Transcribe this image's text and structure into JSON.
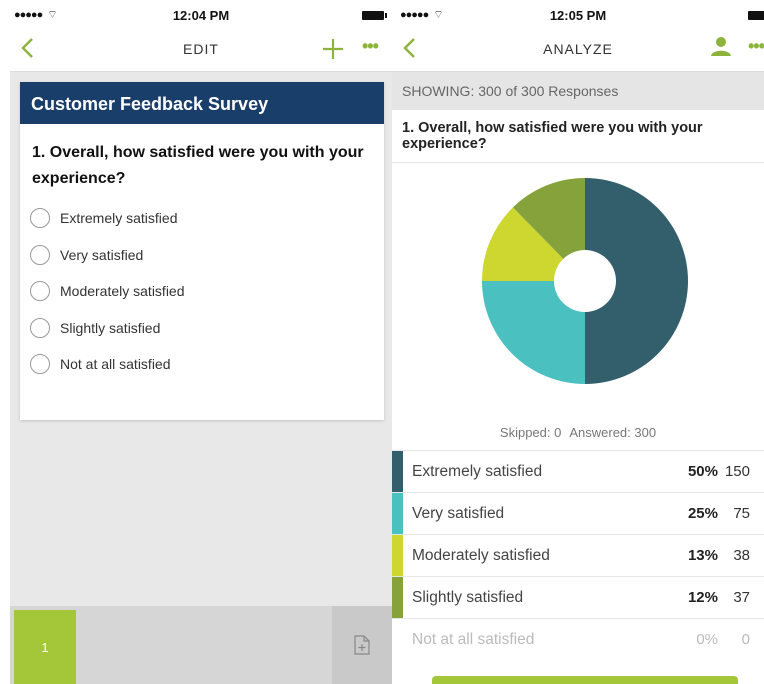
{
  "colors": {
    "accent": "#8cb43c",
    "header_blue": "#1a3e6a",
    "page_tab": "#a4c639",
    "series": [
      "#325f6b",
      "#4bc0c0",
      "#cdd730",
      "#86a23a",
      "#eeeeee"
    ]
  },
  "left": {
    "status": {
      "time": "12:04 PM",
      "signal_icon": "signal-dots-icon",
      "wifi_icon": "wifi-icon",
      "battery_icon": "battery-icon"
    },
    "nav": {
      "back_icon": "chevron-left-icon",
      "title": "EDIT",
      "add_icon": "plus-icon",
      "more_icon": "more-dots-icon"
    },
    "survey": {
      "title": "Customer Feedback Survey",
      "question": "1. Overall, how satisfied were you with your experience?",
      "options": [
        "Extremely satisfied",
        "Very satisfied",
        "Moderately satisfied",
        "Slightly satisfied",
        "Not at all satisfied"
      ]
    },
    "bottom": {
      "page_label": "1",
      "add_page_icon": "add-page-icon"
    }
  },
  "right": {
    "status": {
      "time": "12:05 PM"
    },
    "nav": {
      "back_icon": "chevron-left-icon",
      "title": "ANALYZE",
      "user_icon": "user-icon",
      "more_icon": "more-dots-icon"
    },
    "showing": "SHOWING: 300 of 300 Responses",
    "question": "1. Overall, how satisfied were you with your experience?",
    "skipped": "Skipped: 0",
    "answered": "Answered: 300",
    "results": [
      {
        "label": "Extremely satisfied",
        "pct": "50%",
        "count": "150"
      },
      {
        "label": "Very satisfied",
        "pct": "25%",
        "count": "75"
      },
      {
        "label": "Moderately satisfied",
        "pct": "13%",
        "count": "38"
      },
      {
        "label": "Slightly satisfied",
        "pct": "12%",
        "count": "37"
      },
      {
        "label": "Not at all satisfied",
        "pct": "0%",
        "count": "0"
      }
    ]
  },
  "chart_data": {
    "type": "pie",
    "categories": [
      "Extremely satisfied",
      "Very satisfied",
      "Moderately satisfied",
      "Slightly satisfied",
      "Not at all satisfied"
    ],
    "values": [
      150,
      75,
      38,
      37,
      0
    ],
    "donut": true
  }
}
